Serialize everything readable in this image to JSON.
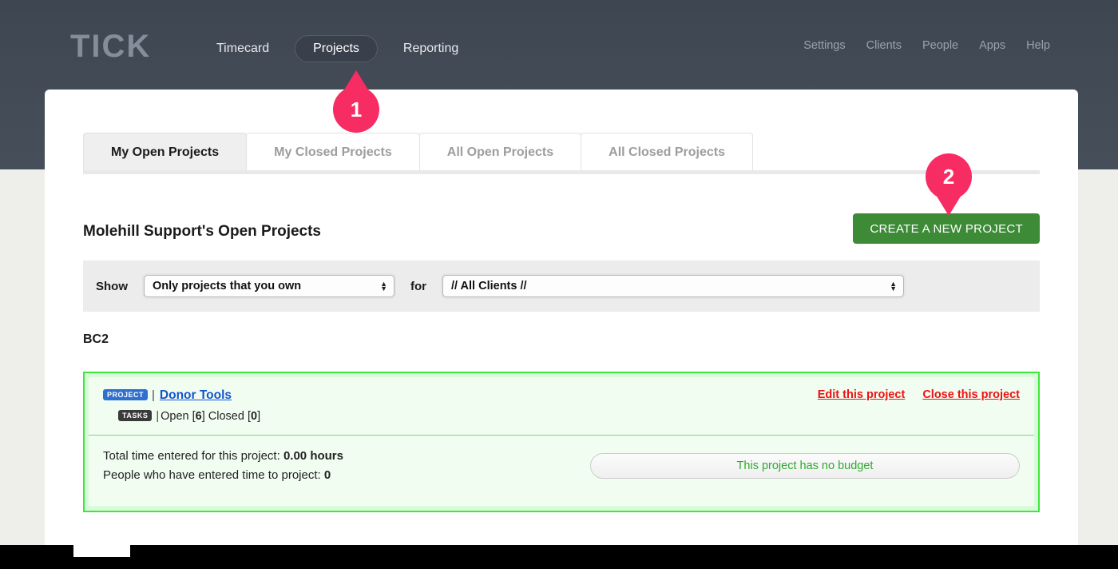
{
  "brand": {
    "logo": "TICK"
  },
  "nav": {
    "main": [
      {
        "label": "Timecard",
        "active": false
      },
      {
        "label": "Projects",
        "active": true
      },
      {
        "label": "Reporting",
        "active": false
      }
    ],
    "right": [
      {
        "label": "Settings"
      },
      {
        "label": "Clients"
      },
      {
        "label": "People"
      },
      {
        "label": "Apps"
      },
      {
        "label": "Help"
      }
    ]
  },
  "tabs": [
    {
      "label": "My Open Projects",
      "active": true
    },
    {
      "label": "My Closed Projects",
      "active": false
    },
    {
      "label": "All Open Projects",
      "active": false
    },
    {
      "label": "All Closed Projects",
      "active": false
    }
  ],
  "page": {
    "title": "Molehill Support's Open Projects",
    "create_button": "CREATE A NEW PROJECT"
  },
  "filters": {
    "show_label": "Show",
    "show_value": "Only projects that you own",
    "for_label": "for",
    "client_value": "// All Clients //"
  },
  "group": {
    "name": "BC2"
  },
  "project": {
    "badge_project": "PROJECT",
    "badge_tasks": "TASKS",
    "separator": "|",
    "name": "Donor Tools",
    "tasks_text_prefix": "Open [",
    "tasks_open": "6",
    "tasks_mid": "] Closed [",
    "tasks_closed": "0",
    "tasks_suffix": "]",
    "edit_link": "Edit this project",
    "close_link": "Close this project",
    "total_time_label": "Total time entered for this project:",
    "total_time_value": "0.00 hours",
    "people_label": "People who have entered time to project:",
    "people_value": "0",
    "budget_text": "This project has no budget"
  },
  "markers": [
    {
      "number": "1"
    },
    {
      "number": "2"
    }
  ],
  "colors": {
    "accent_pink": "#f72c62",
    "green_button": "#3d8b37",
    "card_border_green": "#3ce83c",
    "link_blue": "#1155cc",
    "link_red": "#ee1111",
    "header_dark": "#434b57"
  }
}
